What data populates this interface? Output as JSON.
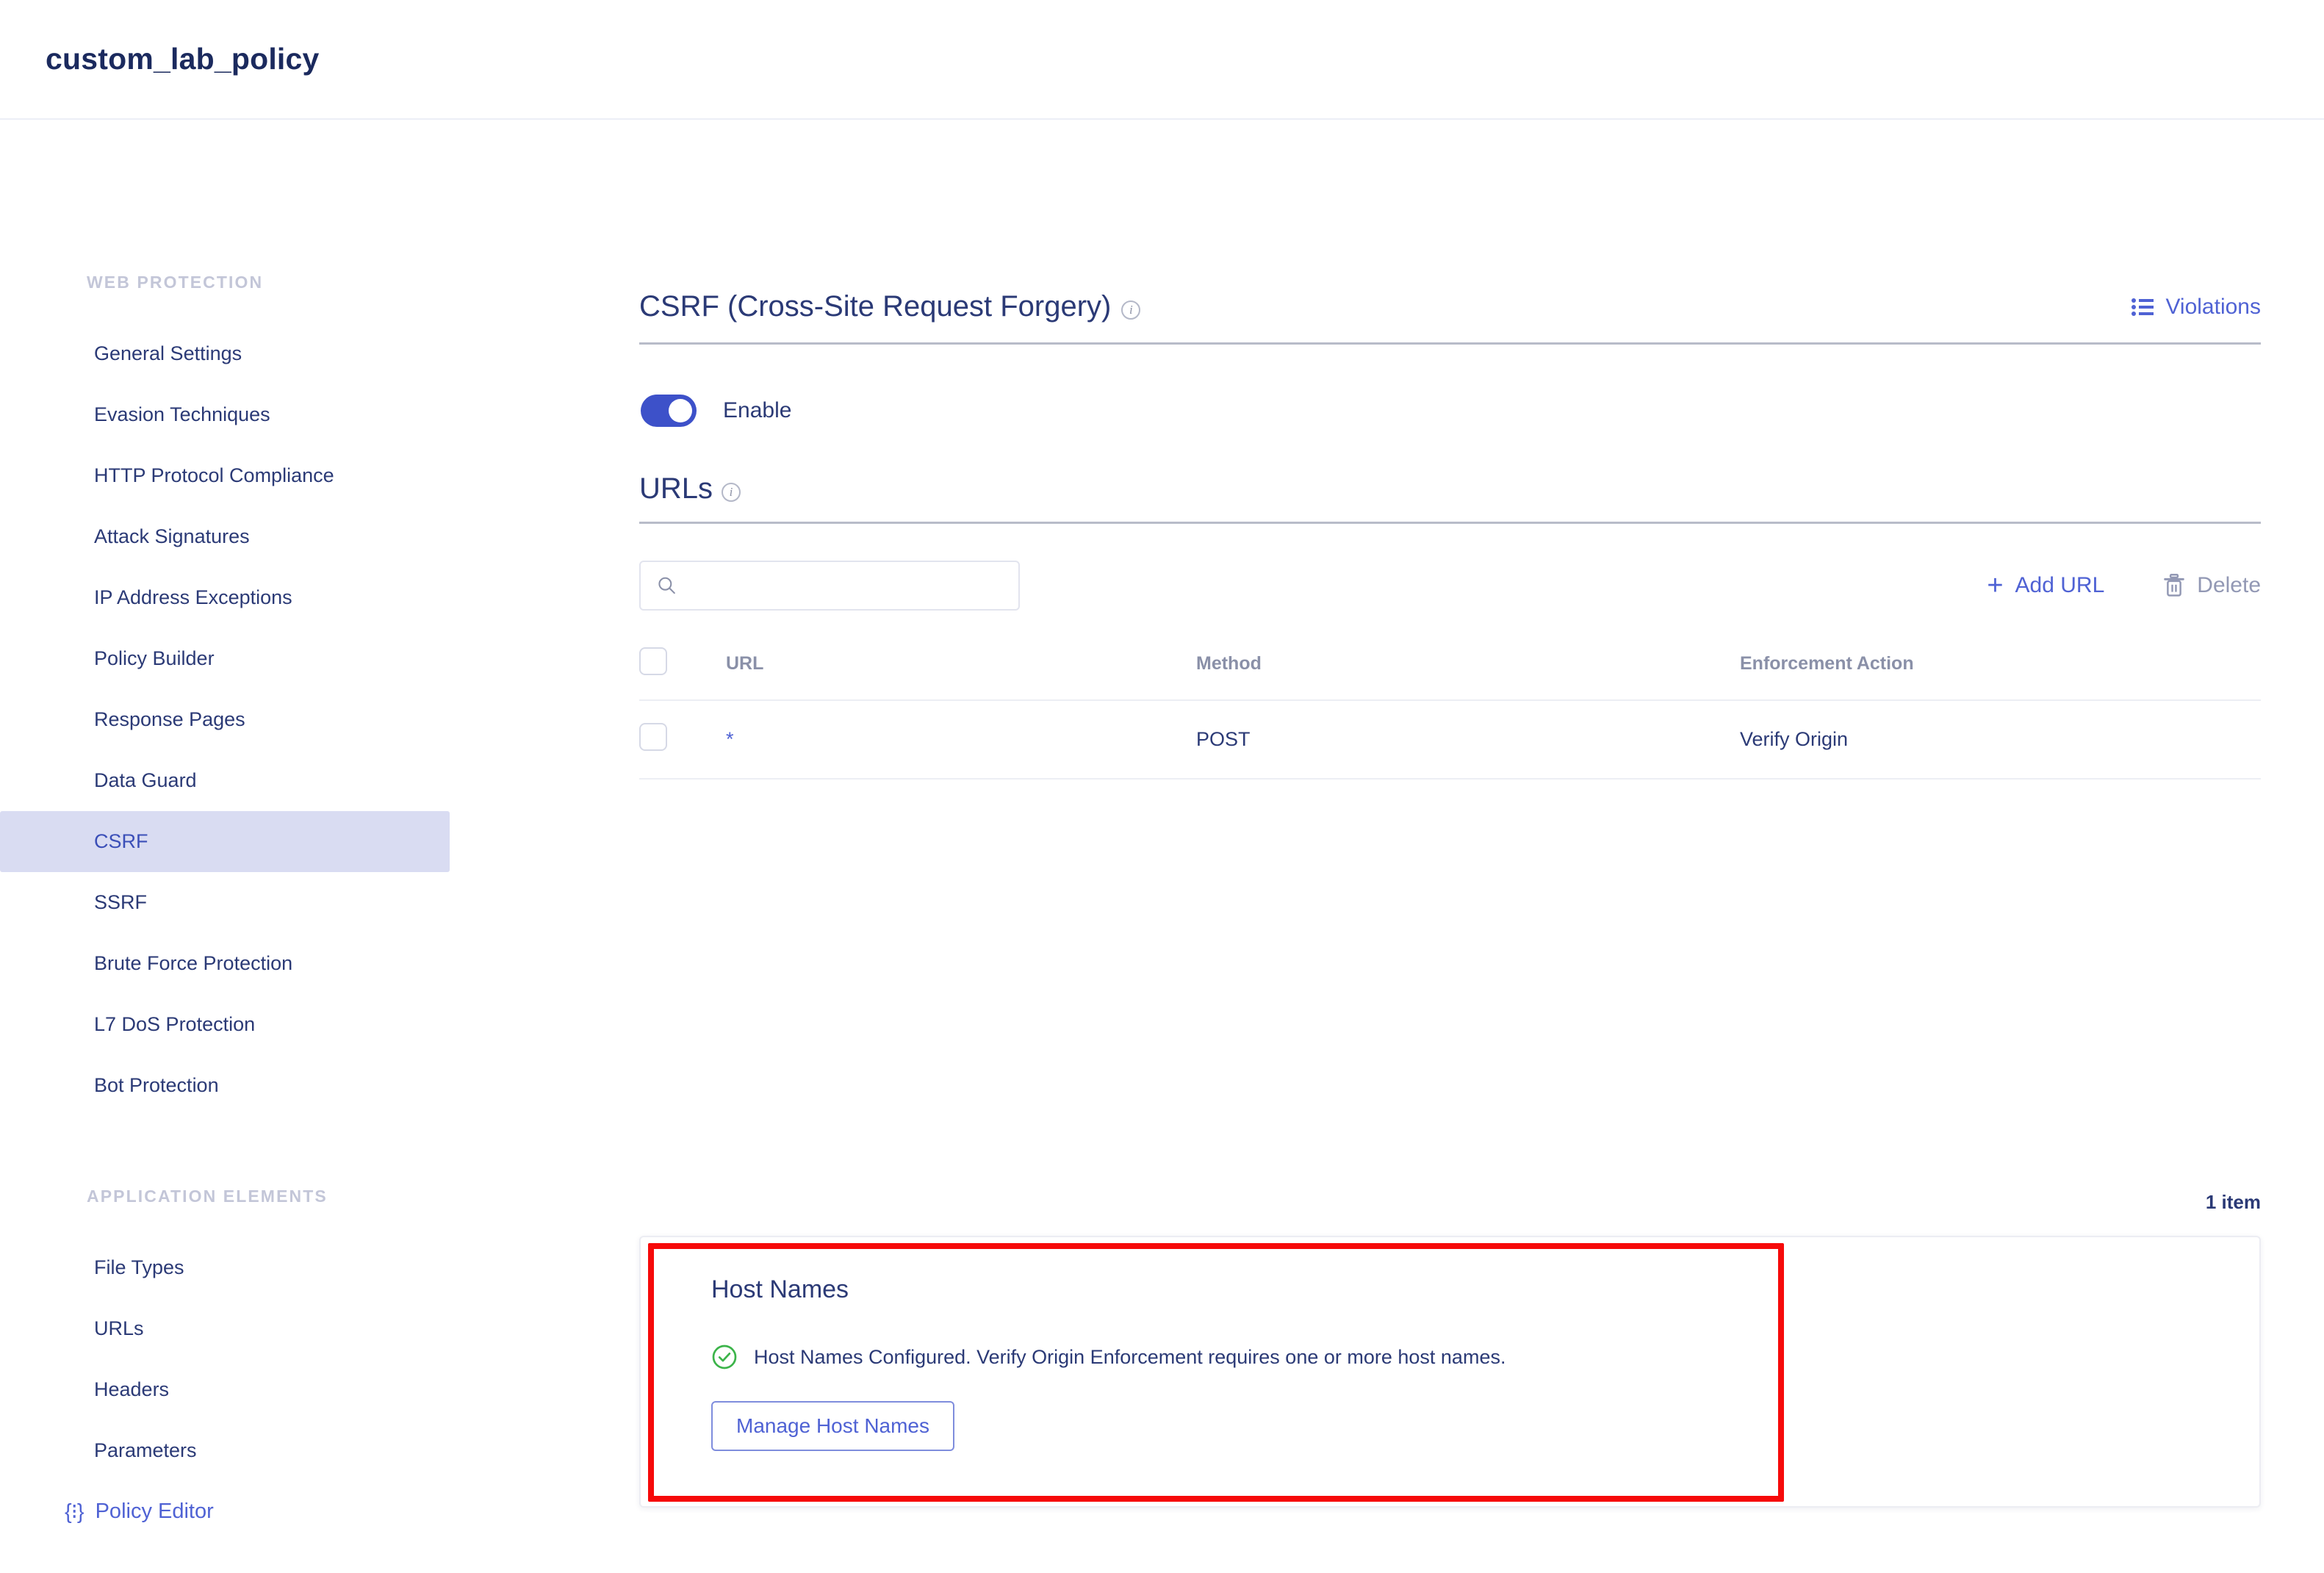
{
  "header": {
    "title": "custom_lab_policy"
  },
  "sidebar": {
    "groups": [
      {
        "label": "WEB PROTECTION",
        "items": [
          {
            "label": "General Settings",
            "active": false
          },
          {
            "label": "Evasion Techniques",
            "active": false
          },
          {
            "label": "HTTP Protocol Compliance",
            "active": false
          },
          {
            "label": "Attack Signatures",
            "active": false
          },
          {
            "label": "IP Address Exceptions",
            "active": false
          },
          {
            "label": "Policy Builder",
            "active": false
          },
          {
            "label": "Response Pages",
            "active": false
          },
          {
            "label": "Data Guard",
            "active": false
          },
          {
            "label": "CSRF",
            "active": true
          },
          {
            "label": "SSRF",
            "active": false
          },
          {
            "label": "Brute Force Protection",
            "active": false
          },
          {
            "label": "L7 DoS Protection",
            "active": false
          },
          {
            "label": "Bot Protection",
            "active": false
          }
        ]
      },
      {
        "label": "APPLICATION ELEMENTS",
        "items": [
          {
            "label": "File Types",
            "active": false
          },
          {
            "label": "URLs",
            "active": false
          },
          {
            "label": "Headers",
            "active": false
          },
          {
            "label": "Parameters",
            "active": false
          }
        ]
      }
    ],
    "policy_editor": {
      "label": "Policy Editor",
      "icon": "curly-braces-icon"
    }
  },
  "main": {
    "section": {
      "title": "CSRF (Cross-Site Request Forgery)",
      "info_icon": "info-icon",
      "violations_link": {
        "label": "Violations",
        "icon": "list-icon"
      }
    },
    "enable_toggle": {
      "label": "Enable",
      "state": "on"
    },
    "urls_section": {
      "title": "URLs",
      "info_icon": "info-icon",
      "search": {
        "value": "",
        "placeholder": "",
        "icon": "search-icon"
      },
      "actions": [
        {
          "label": "Add URL",
          "icon": "plus-icon",
          "enabled": true
        },
        {
          "label": "Delete",
          "icon": "trash-icon",
          "enabled": false
        }
      ],
      "columns": [
        "URL",
        "Method",
        "Enforcement Action"
      ],
      "rows": [
        {
          "url": "*",
          "method": "POST",
          "enforcement_action": "Verify Origin",
          "selected": false
        }
      ],
      "item_count": "1 item"
    },
    "host_names_card": {
      "title": "Host Names",
      "status_icon": "check-circle-icon",
      "status_text": "Host Names Configured. Verify Origin Enforcement requires one or more host names.",
      "button_label": "Manage Host Names",
      "highlight_color": "#f60a0a"
    }
  },
  "colors": {
    "accent": "#4f62d4",
    "text_primary": "#2b3a76",
    "muted": "#8a90a8",
    "active_bg": "#d9dcf2",
    "success": "#3cb44a",
    "highlight": "#f60a0a"
  }
}
